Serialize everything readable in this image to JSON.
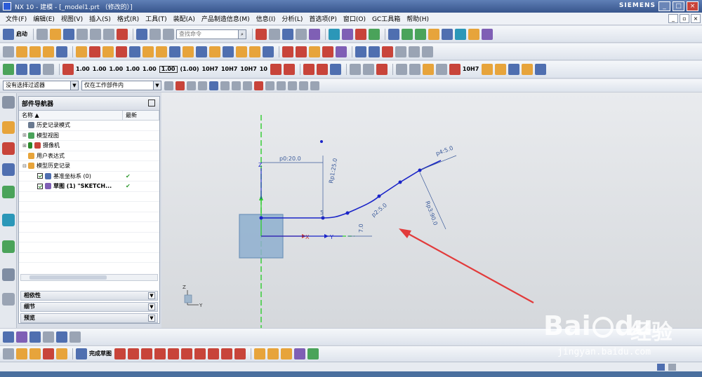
{
  "window": {
    "title": "NX 10 - 建模 - [_model1.prt （修改的）]",
    "brand": "SIEMENS"
  },
  "menu": {
    "items": [
      "文件(F)",
      "编辑(E)",
      "视图(V)",
      "插入(S)",
      "格式(R)",
      "工具(T)",
      "装配(A)",
      "产品制造信息(M)",
      "信息(I)",
      "分析(L)",
      "首选项(P)",
      "窗口(O)",
      "GC工具箱",
      "帮助(H)"
    ]
  },
  "toolbar": {
    "start_label": "启动",
    "search_placeholder": "查找命令",
    "dims": [
      "1.00",
      "1.00",
      "1.00",
      "1.00",
      "1.00",
      "1.00",
      "(1.00)",
      "10H7",
      "10H7",
      "10H7",
      "10"
    ],
    "snap_label": "10H7"
  },
  "filterbar": {
    "type_filter": "没有选择过滤器",
    "scope_filter": "仅在工作部件内"
  },
  "navigator": {
    "title": "部件导航器",
    "col_name": "名称",
    "col_latest": "最新",
    "rows": [
      {
        "label": "历史记录模式",
        "latest": ""
      },
      {
        "label": "模型视图",
        "latest": ""
      },
      {
        "label": "摄像机",
        "latest": ""
      },
      {
        "label": "用户表达式",
        "latest": ""
      },
      {
        "label": "模型历史记录",
        "latest": ""
      },
      {
        "label": "基准坐标系 (0)",
        "latest": "✔"
      },
      {
        "label": "草图 (1) \"SKETCH...",
        "latest": "✔"
      }
    ],
    "sections": [
      "相依性",
      "细节",
      "预览"
    ]
  },
  "sketch": {
    "dimensions": [
      "p0:20.0",
      "Rp1:25.0",
      "p4:5.0",
      "Rp3:90.0",
      "p2:5.0",
      "7.0",
      "5"
    ],
    "axis_labels": {
      "z": "Z",
      "y": "Y",
      "x": "X"
    },
    "triad_labels": {
      "z": "Z",
      "y": "Y"
    }
  },
  "bottom_toolbar": {
    "finish_sketch_label": "完成草图"
  },
  "watermark": {
    "brand": "Bai",
    "brand2": "du",
    "cn": "经验",
    "url": "jingyan.baidu.com"
  },
  "colors": {
    "sketch_curve": "#1a24c8",
    "dimension": "#3a5a9a",
    "axis_green": "#2ecc2e",
    "arrow_red": "#e23b3b",
    "block_fill": "#8fb0d0"
  }
}
